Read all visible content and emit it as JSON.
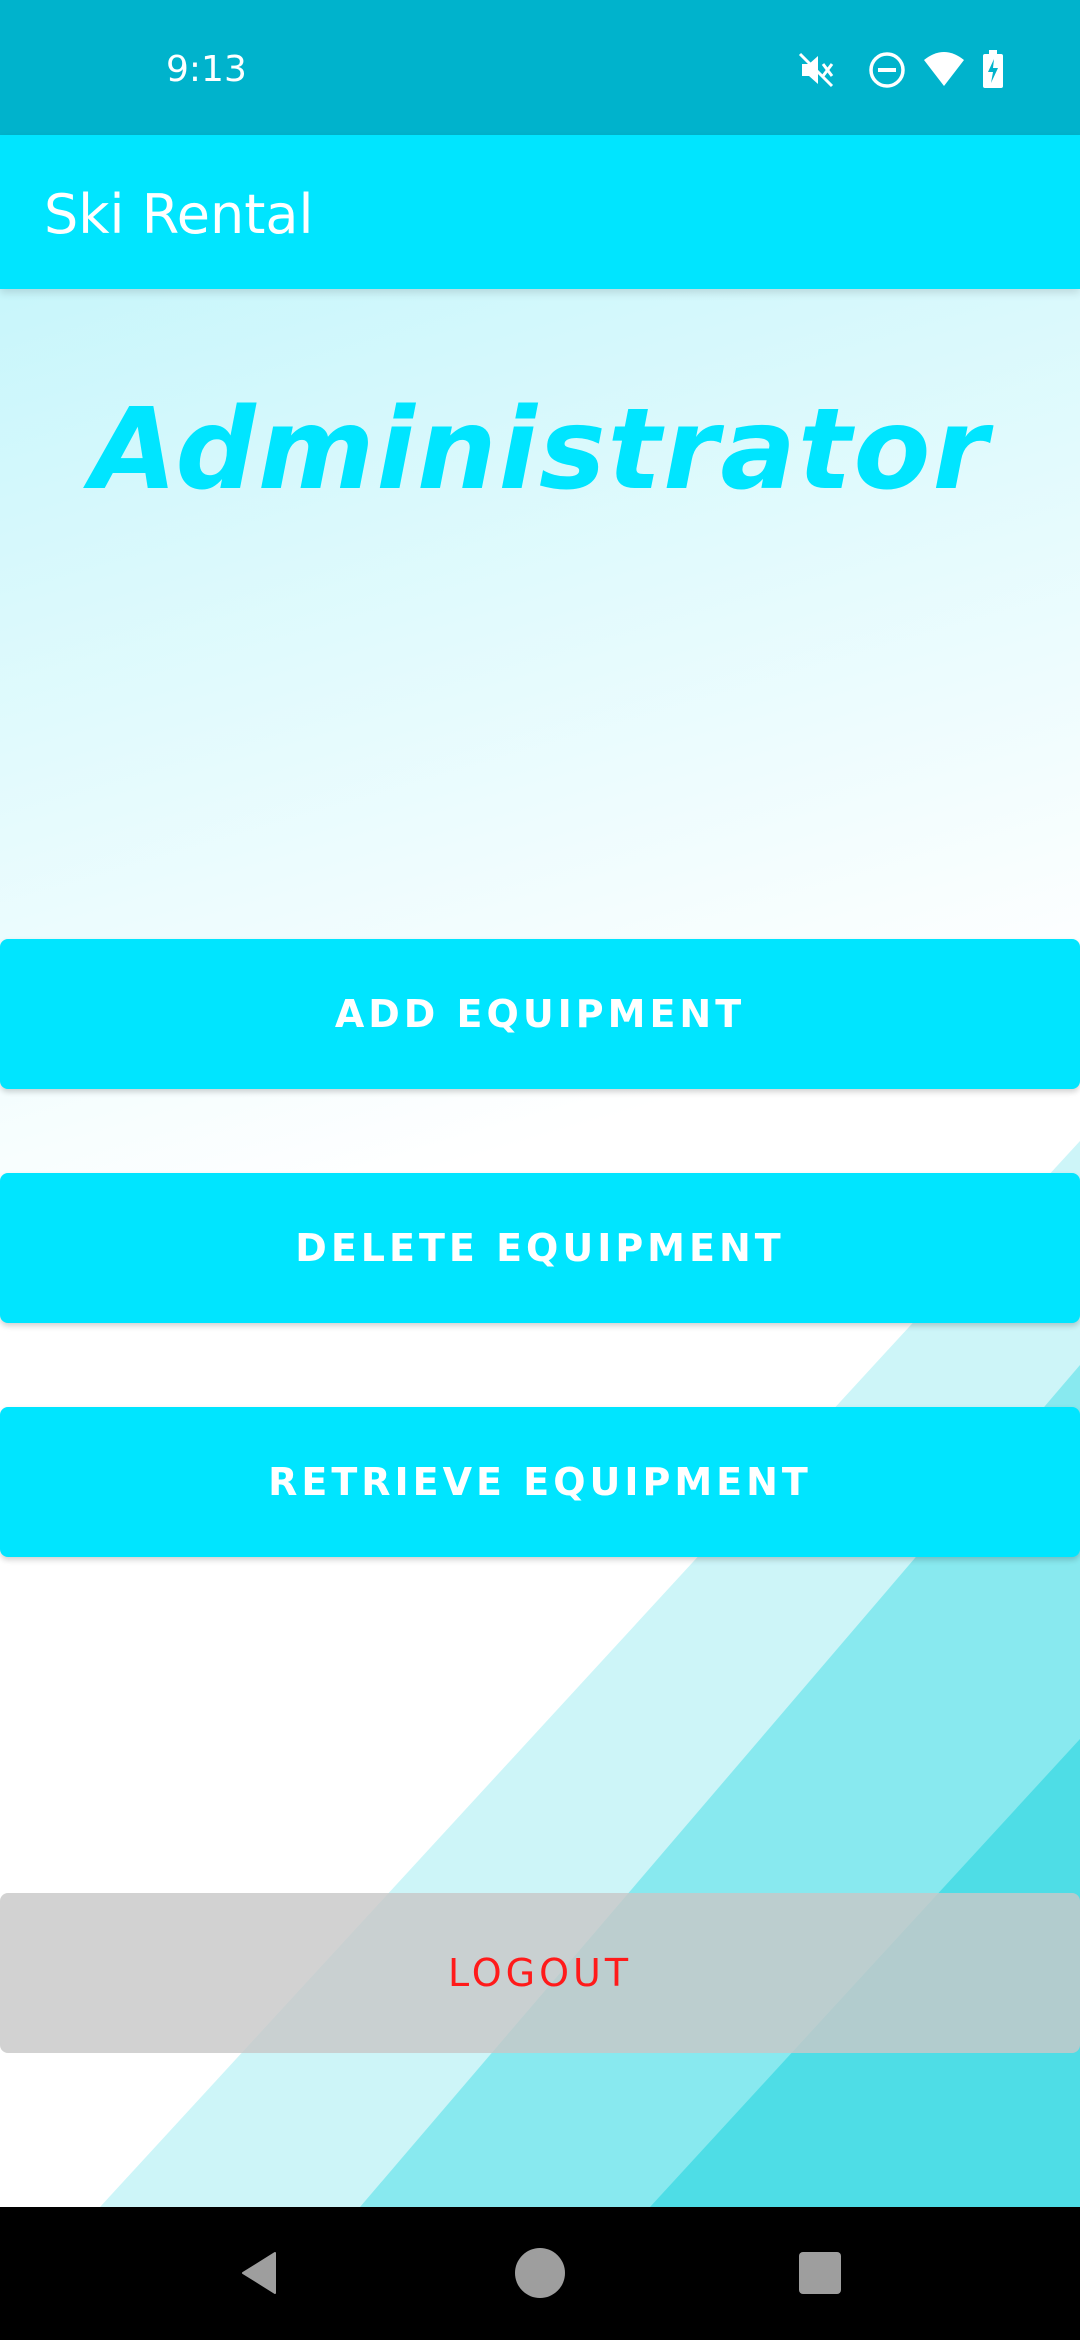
{
  "status_bar": {
    "time": "9:13",
    "icons": [
      "mute-icon",
      "do-not-disturb-icon",
      "wifi-icon",
      "battery-charging-icon"
    ]
  },
  "app_bar": {
    "title": "Ski Rental"
  },
  "main": {
    "heading": "Administrator",
    "buttons": {
      "add": "ADD EQUIPMENT",
      "delete": "DELETE EQUIPMENT",
      "retrieve": "RETRIEVE EQUIPMENT"
    },
    "logout": "LOGOUT"
  },
  "nav_bar": {
    "icons": [
      "back-icon",
      "home-icon",
      "recents-icon"
    ]
  },
  "colors": {
    "status_bar": "#00b3cc",
    "accent": "#00e5ff",
    "logout_text": "#ff1a1a",
    "logout_bg": "#c8c8c8"
  }
}
